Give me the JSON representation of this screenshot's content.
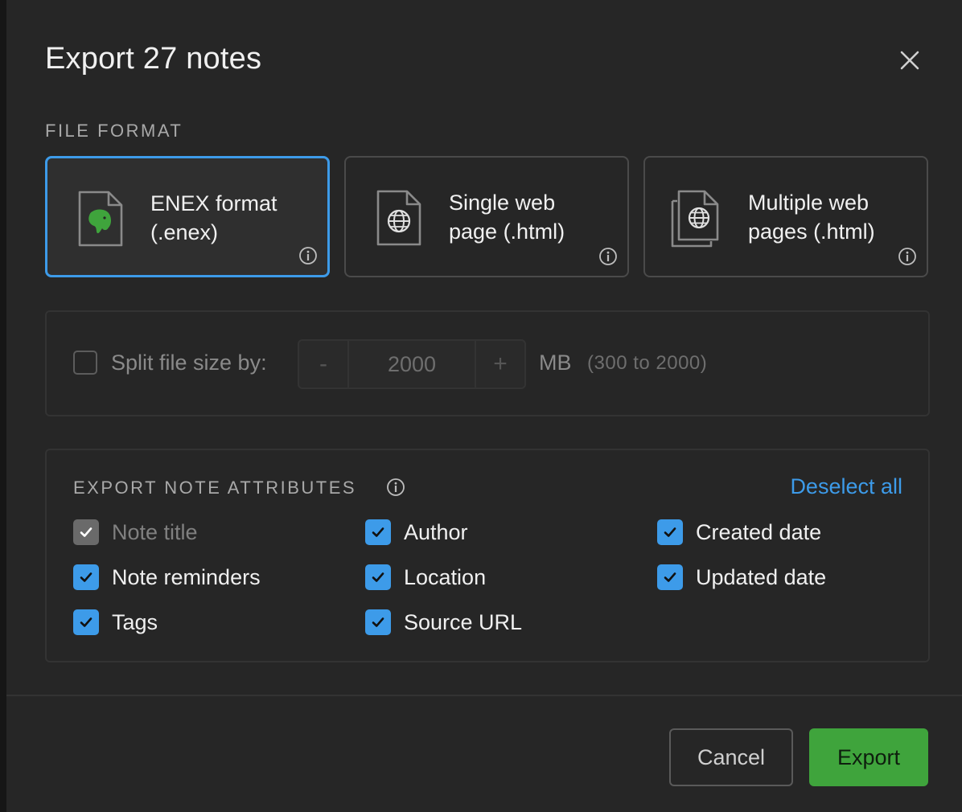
{
  "dialog": {
    "title": "Export 27 notes",
    "close_icon": "close-icon"
  },
  "file_format": {
    "section_label": "FILE FORMAT",
    "options": [
      {
        "line1": "ENEX format",
        "line2": "(.enex)",
        "icon": "evernote-file-icon",
        "selected": true
      },
      {
        "line1": "Single web",
        "line2": "page (.html)",
        "icon": "html-file-icon",
        "selected": false
      },
      {
        "line1": "Multiple web",
        "line2": "pages (.html)",
        "icon": "multiple-html-files-icon",
        "selected": false
      }
    ]
  },
  "split": {
    "label": "Split file size by:",
    "checked": false,
    "minus": "-",
    "plus": "+",
    "value": "2000",
    "unit": "MB",
    "range": "(300 to 2000)"
  },
  "attributes": {
    "section_label": "EXPORT NOTE ATTRIBUTES",
    "deselect_label": "Deselect all",
    "items": [
      {
        "label": "Note title",
        "checked": true,
        "disabled": true
      },
      {
        "label": "Author",
        "checked": true,
        "disabled": false
      },
      {
        "label": "Created date",
        "checked": true,
        "disabled": false
      },
      {
        "label": "Note reminders",
        "checked": true,
        "disabled": false
      },
      {
        "label": "Location",
        "checked": true,
        "disabled": false
      },
      {
        "label": "Updated date",
        "checked": true,
        "disabled": false
      },
      {
        "label": "Tags",
        "checked": true,
        "disabled": false
      },
      {
        "label": "Source URL",
        "checked": true,
        "disabled": false
      }
    ]
  },
  "footer": {
    "cancel_label": "Cancel",
    "export_label": "Export"
  },
  "colors": {
    "accent": "#3d9be9",
    "export_button": "#3fa43c",
    "dialog_bg": "#262626",
    "evernote_green": "#3fa43c"
  }
}
